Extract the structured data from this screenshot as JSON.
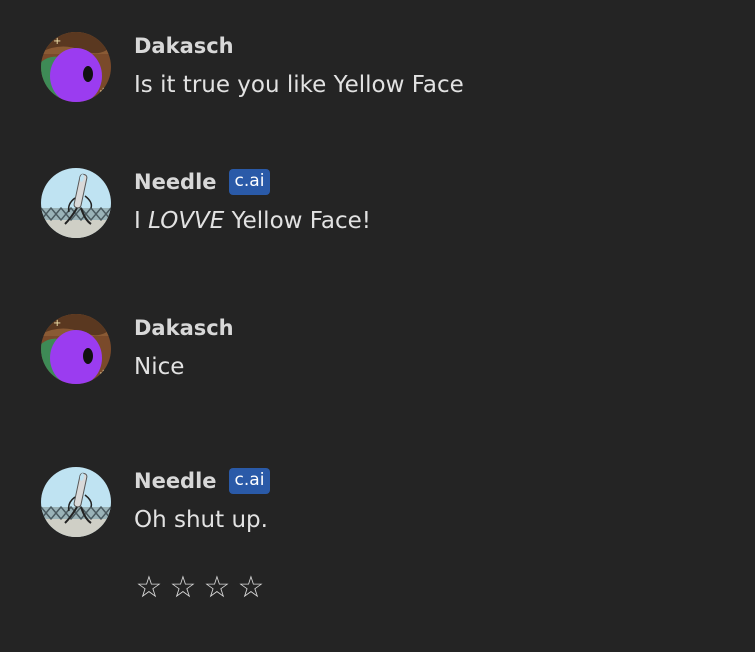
{
  "messages": [
    {
      "author": "Dakasch",
      "badge": "",
      "text": "Is it true you like Yellow Face",
      "avatar": "dakasch-avatar"
    },
    {
      "author": "Needle",
      "badge": "c.ai",
      "text_pre": "I ",
      "text_em": "LOVVE",
      "text_post": " Yellow Face!",
      "avatar": "needle-avatar"
    },
    {
      "author": "Dakasch",
      "badge": "",
      "text": "Nice",
      "avatar": "dakasch-avatar"
    },
    {
      "author": "Needle",
      "badge": "c.ai",
      "text": "Oh shut up.",
      "avatar": "needle-avatar"
    }
  ],
  "rating": {
    "stars": [
      "☆",
      "☆",
      "☆",
      "☆"
    ],
    "selected": 0
  },
  "colors": {
    "background": "#242424",
    "badge": "#2a5aa8",
    "dakasch_purple": "#9b3cf0",
    "needle_sky": "#bfe3f2"
  }
}
